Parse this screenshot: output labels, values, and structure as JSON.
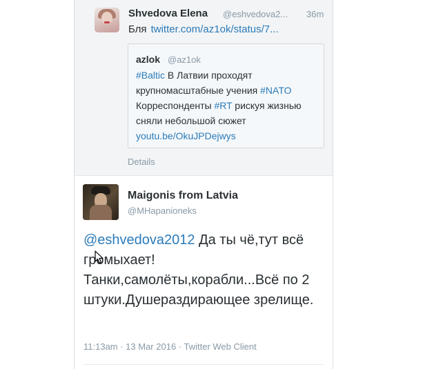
{
  "tweet_reply": {
    "author_name": "Shvedova Elena",
    "author_handle": "@eshvedova2...",
    "time": "36m",
    "text": "Бля",
    "link": "twitter.com/az1ok/status/7..."
  },
  "quoted_tweet": {
    "author_name": "azlok",
    "author_handle": "@az1ok",
    "hashtag_baltic": "#Baltic",
    "text_part1": " В Латвии проходят крупномасштабные учения ",
    "hashtag_nato": "#NATO",
    "text_part2": " Корреспонденты ",
    "hashtag_rt": "#RT",
    "text_part3": " рискуя жизнью сняли небольшой сюжет ",
    "link": "youtu.be/OkuJPDejwys"
  },
  "details_label": "Details",
  "main_tweet": {
    "author_name": "Maigonis from Latvia",
    "author_handle": "@MHapanioneks",
    "mention": "@eshvedova2012",
    "text": " Да ты чё,тут всё громыхает! Танки,самолёты,корабли...Всё по 2 штуки.Душераздирающее зрелище.",
    "timestamp": "11:13am · 13 Mar 2016 · Twitter Web Client"
  },
  "colors": {
    "link": "#2b7bb9",
    "muted": "#8899a6",
    "text": "#292f33"
  }
}
